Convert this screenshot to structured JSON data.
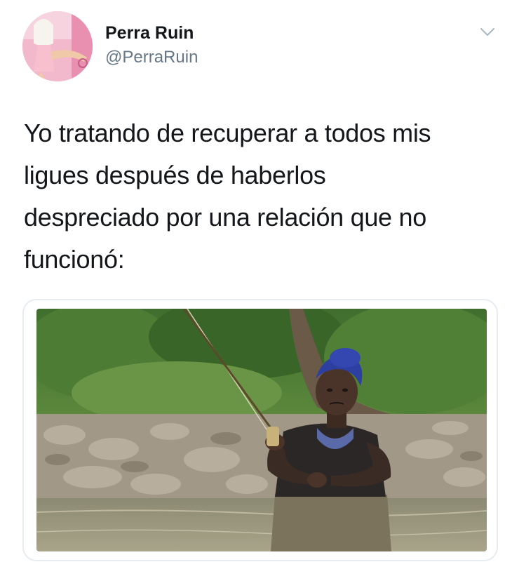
{
  "author": {
    "display_name": "Perra Ruin",
    "handle": "@PerraRuin",
    "avatar_icon": "profile-avatar"
  },
  "menu": {
    "icon": "chevron-down-icon"
  },
  "tweet": {
    "text": "Yo tratando de recuperar a todos mis\nligues después de haberlos\ndespreciado por una relación que no\nfuncionó:"
  },
  "media": {
    "kind": "photo"
  },
  "colors": {
    "text_primary": "#14171a",
    "text_secondary": "#657786",
    "border": "#e6ecf0"
  }
}
